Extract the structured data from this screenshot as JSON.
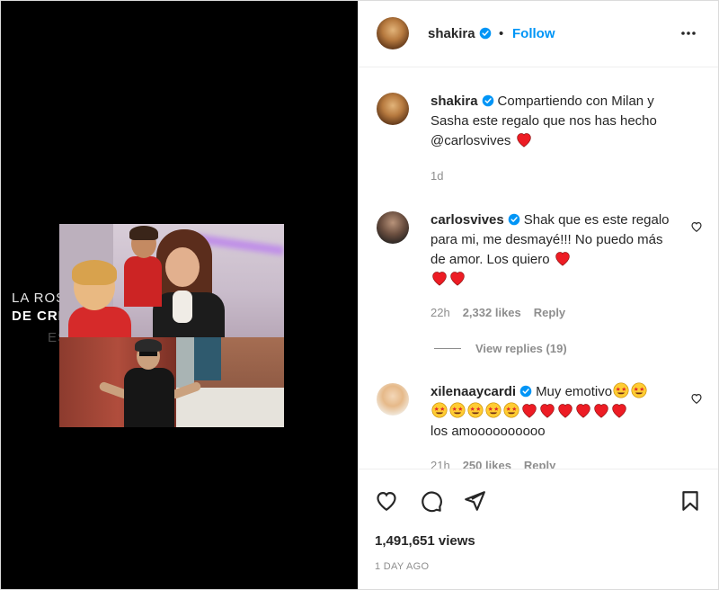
{
  "post": {
    "author": "shakira",
    "follow_label": "Follow",
    "separator": "•",
    "verified_color": "#0095f6",
    "heart_color": "#ed1c24"
  },
  "media": {
    "overlay_line1": "LA ROSA",
    "overlay_line2": "DE CRISTAL",
    "overlay_line3": "ES EL"
  },
  "caption": {
    "username": "shakira",
    "text": "Compartiendo con Milan y Sasha este regalo que nos has hecho @carlosvives",
    "emoji_after": "red-heart",
    "time": "1d"
  },
  "comments": [
    {
      "username": "carlosvives",
      "text": "Shak que es este regalo para mi, me desmayé!!! No puedo más de amor. Los quiero",
      "emojis": [
        "red-heart",
        "red-heart",
        "red-heart"
      ],
      "time": "22h",
      "likes": "2,332 likes",
      "reply": "Reply",
      "view_replies": "View replies (19)"
    },
    {
      "username": "xilenaaycardi",
      "text_start": "Muy emotivo",
      "text_end": "los amoooooooooo",
      "emojis": [
        "star-struck",
        "star-struck",
        "star-struck",
        "star-struck",
        "star-struck",
        "star-struck",
        "star-struck",
        "red-heart",
        "red-heart",
        "red-heart",
        "red-heart",
        "red-heart",
        "red-heart"
      ],
      "time": "21h",
      "likes": "250 likes",
      "reply": "Reply"
    }
  ],
  "actions": {
    "icons": [
      "heart-icon",
      "comment-icon",
      "share-icon",
      "bookmark-icon"
    ],
    "views": "1,491,651 views",
    "date": "1 DAY AGO"
  }
}
